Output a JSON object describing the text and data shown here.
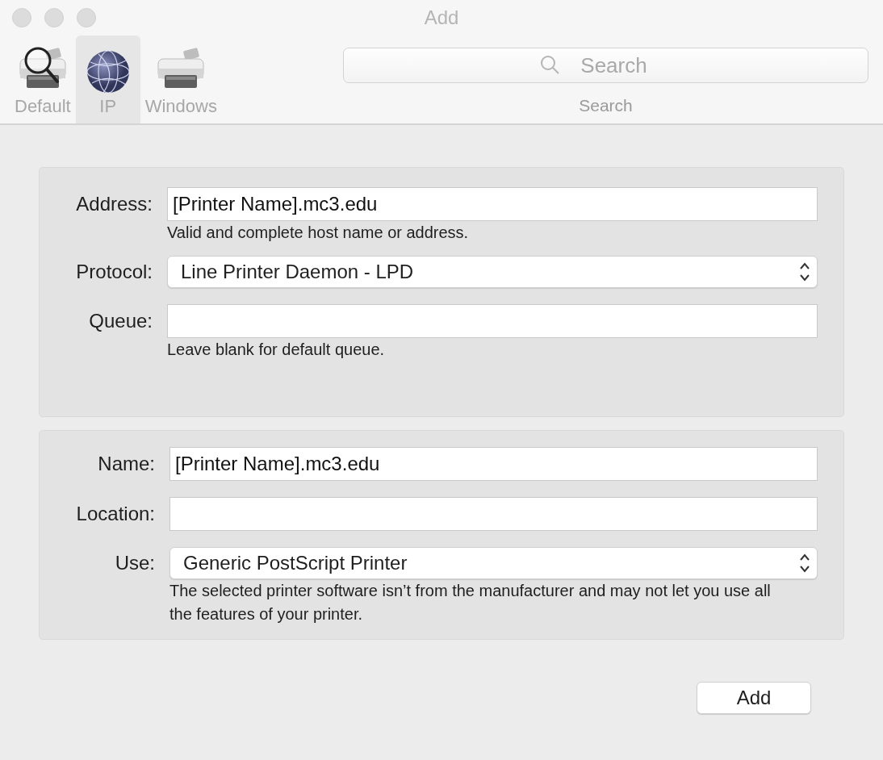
{
  "window": {
    "title": "Add"
  },
  "toolbar": {
    "tabs": [
      {
        "label": "Default",
        "kind": "printer-search",
        "selected": false
      },
      {
        "label": "IP",
        "kind": "globe",
        "selected": true
      },
      {
        "label": "Windows",
        "kind": "printer",
        "selected": false
      }
    ],
    "search": {
      "placeholder": "Search",
      "label": "Search"
    }
  },
  "sections": [
    {
      "rows": [
        {
          "label": "Address:",
          "kind": "text",
          "value": "[Printer Name].mc3.edu",
          "hint": "Valid and complete host name or address."
        },
        {
          "label": "Protocol:",
          "kind": "popup",
          "value": "Line Printer Daemon - LPD"
        },
        {
          "label": "Queue:",
          "kind": "text",
          "value": "",
          "hint": "Leave blank for default queue."
        }
      ]
    },
    {
      "rows": [
        {
          "label": "Name:",
          "kind": "text",
          "value": "[Printer Name].mc3.edu"
        },
        {
          "label": "Location:",
          "kind": "text",
          "value": ""
        },
        {
          "label": "Use:",
          "kind": "popup",
          "value": "Generic PostScript Printer",
          "hint": "The selected printer software isn’t from the manufacturer and may not let you use all the features of your printer."
        }
      ]
    }
  ],
  "buttons": [
    {
      "label": "Add"
    }
  ]
}
